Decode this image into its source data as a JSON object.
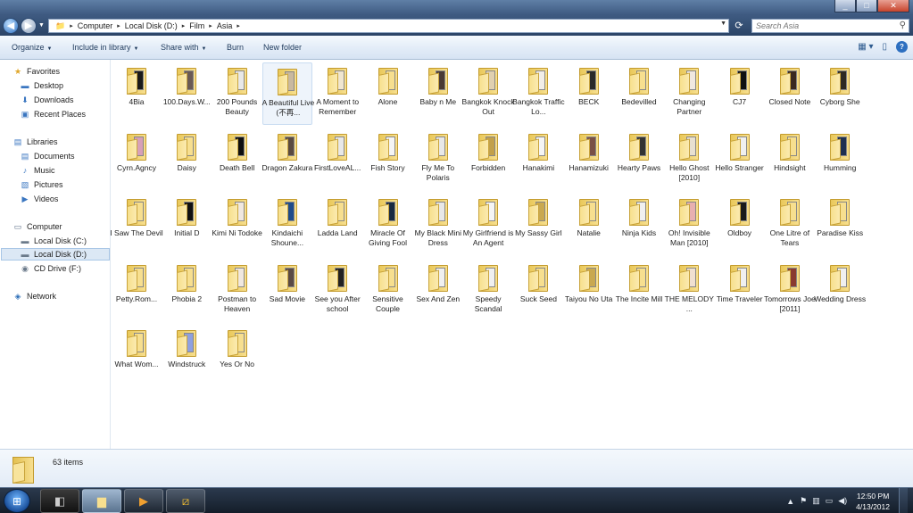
{
  "window": {
    "controls": [
      "_",
      "□",
      "✕"
    ],
    "address": [
      "Computer",
      "Local Disk (D:)",
      "Film",
      "Asia"
    ],
    "search_placeholder": "Search Asia"
  },
  "toolbar": {
    "organize": "Organize",
    "include": "Include in library",
    "share": "Share with",
    "burn": "Burn",
    "new_folder": "New folder"
  },
  "nav": {
    "favorites": "Favorites",
    "desktop": "Desktop",
    "downloads": "Downloads",
    "recent": "Recent Places",
    "libraries": "Libraries",
    "documents": "Documents",
    "music": "Music",
    "pictures": "Pictures",
    "videos": "Videos",
    "computer": "Computer",
    "disk_c": "Local Disk (C:)",
    "disk_d": "Local Disk (D:)",
    "cd": "CD Drive (F:)",
    "network": "Network"
  },
  "folders": [
    {
      "name": "4Bia",
      "thumb": "#1a1a1a"
    },
    {
      "name": "100.Days.W...",
      "thumb": "#6a5a55"
    },
    {
      "name": "200 Pounds Beauty",
      "thumb": "#e8e8e8"
    },
    {
      "name": "A Beautiful Live (不再...",
      "thumb": "#c9b9a0"
    },
    {
      "name": "A Moment to Remember",
      "thumb": "#f0e6d0"
    },
    {
      "name": "Alone",
      "thumb": "#f7df8f"
    },
    {
      "name": "Baby n Me",
      "thumb": "#4a3a35"
    },
    {
      "name": "Bangkok Knock Out",
      "thumb": "#e0d0b0"
    },
    {
      "name": "Bangkok Traffic Lo...",
      "thumb": "#f2eee8"
    },
    {
      "name": "BECK",
      "thumb": "#2a2a2a"
    },
    {
      "name": "Bedevilled",
      "thumb": "#f7df8f"
    },
    {
      "name": "Changing Partner",
      "thumb": "#f0e8e0"
    },
    {
      "name": "CJ7",
      "thumb": "#111111"
    },
    {
      "name": "Closed Note",
      "thumb": "#3b2a20"
    },
    {
      "name": "Cyborg She",
      "thumb": "#2e2a22"
    },
    {
      "name": "Cyrn.Agncy",
      "thumb": "#d7a0b8"
    },
    {
      "name": "Daisy",
      "thumb": "#f7df8f"
    },
    {
      "name": "Death Bell",
      "thumb": "#0f0f0f"
    },
    {
      "name": "Dragon Zakura",
      "thumb": "#5a4a40"
    },
    {
      "name": "FirstLoveAL...",
      "thumb": "#e8e8e8"
    },
    {
      "name": "Fish Story",
      "thumb": "#f5f5f5"
    },
    {
      "name": "Fly Me To Polaris",
      "thumb": "#e8e8e8"
    },
    {
      "name": "Forbidden",
      "thumb": "#c2a04a"
    },
    {
      "name": "Hanakimi",
      "thumb": "#f5f5f5"
    },
    {
      "name": "Hanamizuki",
      "thumb": "#7a5045"
    },
    {
      "name": "Hearty Paws",
      "thumb": "#333333"
    },
    {
      "name": "Hello Ghost [2010]",
      "thumb": "#e8e0d0"
    },
    {
      "name": "Hello Stranger",
      "thumb": "#f0f0f0"
    },
    {
      "name": "Hindsight",
      "thumb": "#f7df8f"
    },
    {
      "name": "Humming",
      "thumb": "#1f3050"
    },
    {
      "name": "I Saw The Devil",
      "thumb": "#f7df8f"
    },
    {
      "name": "Initial D",
      "thumb": "#111111"
    },
    {
      "name": "Kimi Ni Todoke",
      "thumb": "#f0e8e0"
    },
    {
      "name": "Kindaichi Shoune...",
      "thumb": "#1f4b8a"
    },
    {
      "name": "Ladda Land",
      "thumb": "#f7df8f"
    },
    {
      "name": "Miracle Of Giving Fool",
      "thumb": "#1a2a40"
    },
    {
      "name": "My Black Mini Dress",
      "thumb": "#e8e8e8"
    },
    {
      "name": "My Girlfriend is An Agent",
      "thumb": "#f5f5f5"
    },
    {
      "name": "My Sassy Girl",
      "thumb": "#c9a850"
    },
    {
      "name": "Natalie",
      "thumb": "#f7df8f"
    },
    {
      "name": "Ninja Kids",
      "thumb": "#f0f0f0"
    },
    {
      "name": "Oh! Invisible Man [2010]",
      "thumb": "#e8b0b0"
    },
    {
      "name": "Oldboy",
      "thumb": "#1a1a1a"
    },
    {
      "name": "One Litre of Tears",
      "thumb": "#f7df8f"
    },
    {
      "name": "Paradise Kiss",
      "thumb": "#f7df8f"
    },
    {
      "name": "Petty.Rom...",
      "thumb": "#f7df8f"
    },
    {
      "name": "Phobia 2",
      "thumb": "#f7df8f"
    },
    {
      "name": "Postman to Heaven",
      "thumb": "#f0e8e0"
    },
    {
      "name": "Sad Movie",
      "thumb": "#5a4a45"
    },
    {
      "name": "See you After school",
      "thumb": "#222222"
    },
    {
      "name": "Sensitive Couple",
      "thumb": "#f7df8f"
    },
    {
      "name": "Sex And Zen",
      "thumb": "#f0f0f0"
    },
    {
      "name": "Speedy Scandal",
      "thumb": "#f0f0f0"
    },
    {
      "name": "Suck Seed",
      "thumb": "#f7df8f"
    },
    {
      "name": "Taiyou No Uta",
      "thumb": "#c9a850"
    },
    {
      "name": "The Incite Mill",
      "thumb": "#f7df8f"
    },
    {
      "name": "THE MELODY ...",
      "thumb": "#f0e0d0"
    },
    {
      "name": "Time Traveler",
      "thumb": "#f0f0f0"
    },
    {
      "name": "Tomorrows Joe [2011]",
      "thumb": "#8a3a30"
    },
    {
      "name": "Wedding Dress",
      "thumb": "#f0f0f0"
    },
    {
      "name": "What Wom...",
      "thumb": "#f7df8f"
    },
    {
      "name": "Windstruck",
      "thumb": "#8fa0e0"
    },
    {
      "name": "Yes Or No",
      "thumb": "#f7df8f"
    }
  ],
  "status": {
    "count": "63 items"
  },
  "taskbar": {
    "time": "12:50 PM",
    "date": "4/13/2012"
  }
}
